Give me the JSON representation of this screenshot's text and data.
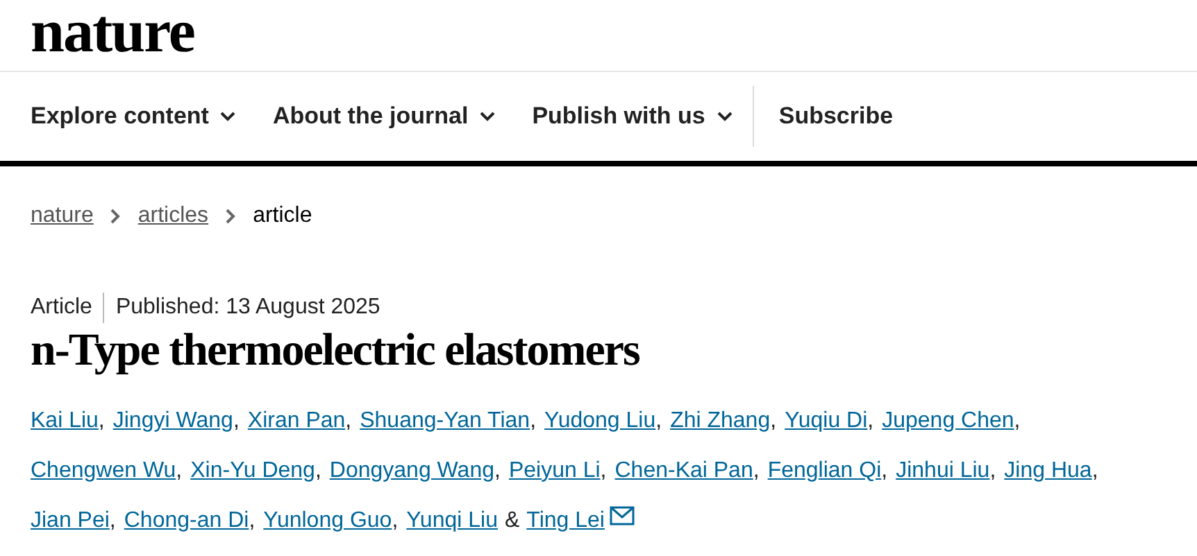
{
  "logo": "nature",
  "nav": [
    {
      "label": "Explore content",
      "dropdown": true
    },
    {
      "label": "About the journal",
      "dropdown": true
    },
    {
      "label": "Publish with us",
      "dropdown": true
    },
    {
      "label": "Subscribe",
      "dropdown": false
    }
  ],
  "breadcrumbs": [
    {
      "label": "nature",
      "link": true
    },
    {
      "label": "articles",
      "link": true
    },
    {
      "label": "article",
      "link": false
    }
  ],
  "article_type": "Article",
  "published": "Published: 13 August 2025",
  "title": "n-Type thermoelectric elastomers",
  "author_lines": [
    [
      {
        "name": "Kai Liu",
        "sep": ","
      },
      {
        "name": "Jingyi Wang",
        "sep": ","
      },
      {
        "name": "Xiran Pan",
        "sep": ","
      },
      {
        "name": "Shuang-Yan Tian",
        "sep": ","
      },
      {
        "name": "Yudong Liu",
        "sep": ","
      },
      {
        "name": "Zhi Zhang",
        "sep": ","
      },
      {
        "name": "Yuqiu Di",
        "sep": ","
      },
      {
        "name": "Jupeng Chen",
        "sep": ","
      }
    ],
    [
      {
        "name": "Chengwen Wu",
        "sep": ","
      },
      {
        "name": "Xin-Yu Deng",
        "sep": ","
      },
      {
        "name": "Dongyang Wang",
        "sep": ","
      },
      {
        "name": "Peiyun Li",
        "sep": ","
      },
      {
        "name": "Chen-Kai Pan",
        "sep": ","
      },
      {
        "name": "Fenglian Qi",
        "sep": ","
      },
      {
        "name": "Jinhui Liu",
        "sep": ","
      },
      {
        "name": "Jing Hua",
        "sep": ","
      }
    ],
    [
      {
        "name": "Jian Pei",
        "sep": ","
      },
      {
        "name": "Chong-an Di",
        "sep": ","
      },
      {
        "name": "Yunlong Guo",
        "sep": ","
      },
      {
        "name": "Yunqi Liu",
        "sep": "&"
      },
      {
        "name": "Ting Lei",
        "email": true
      }
    ]
  ]
}
